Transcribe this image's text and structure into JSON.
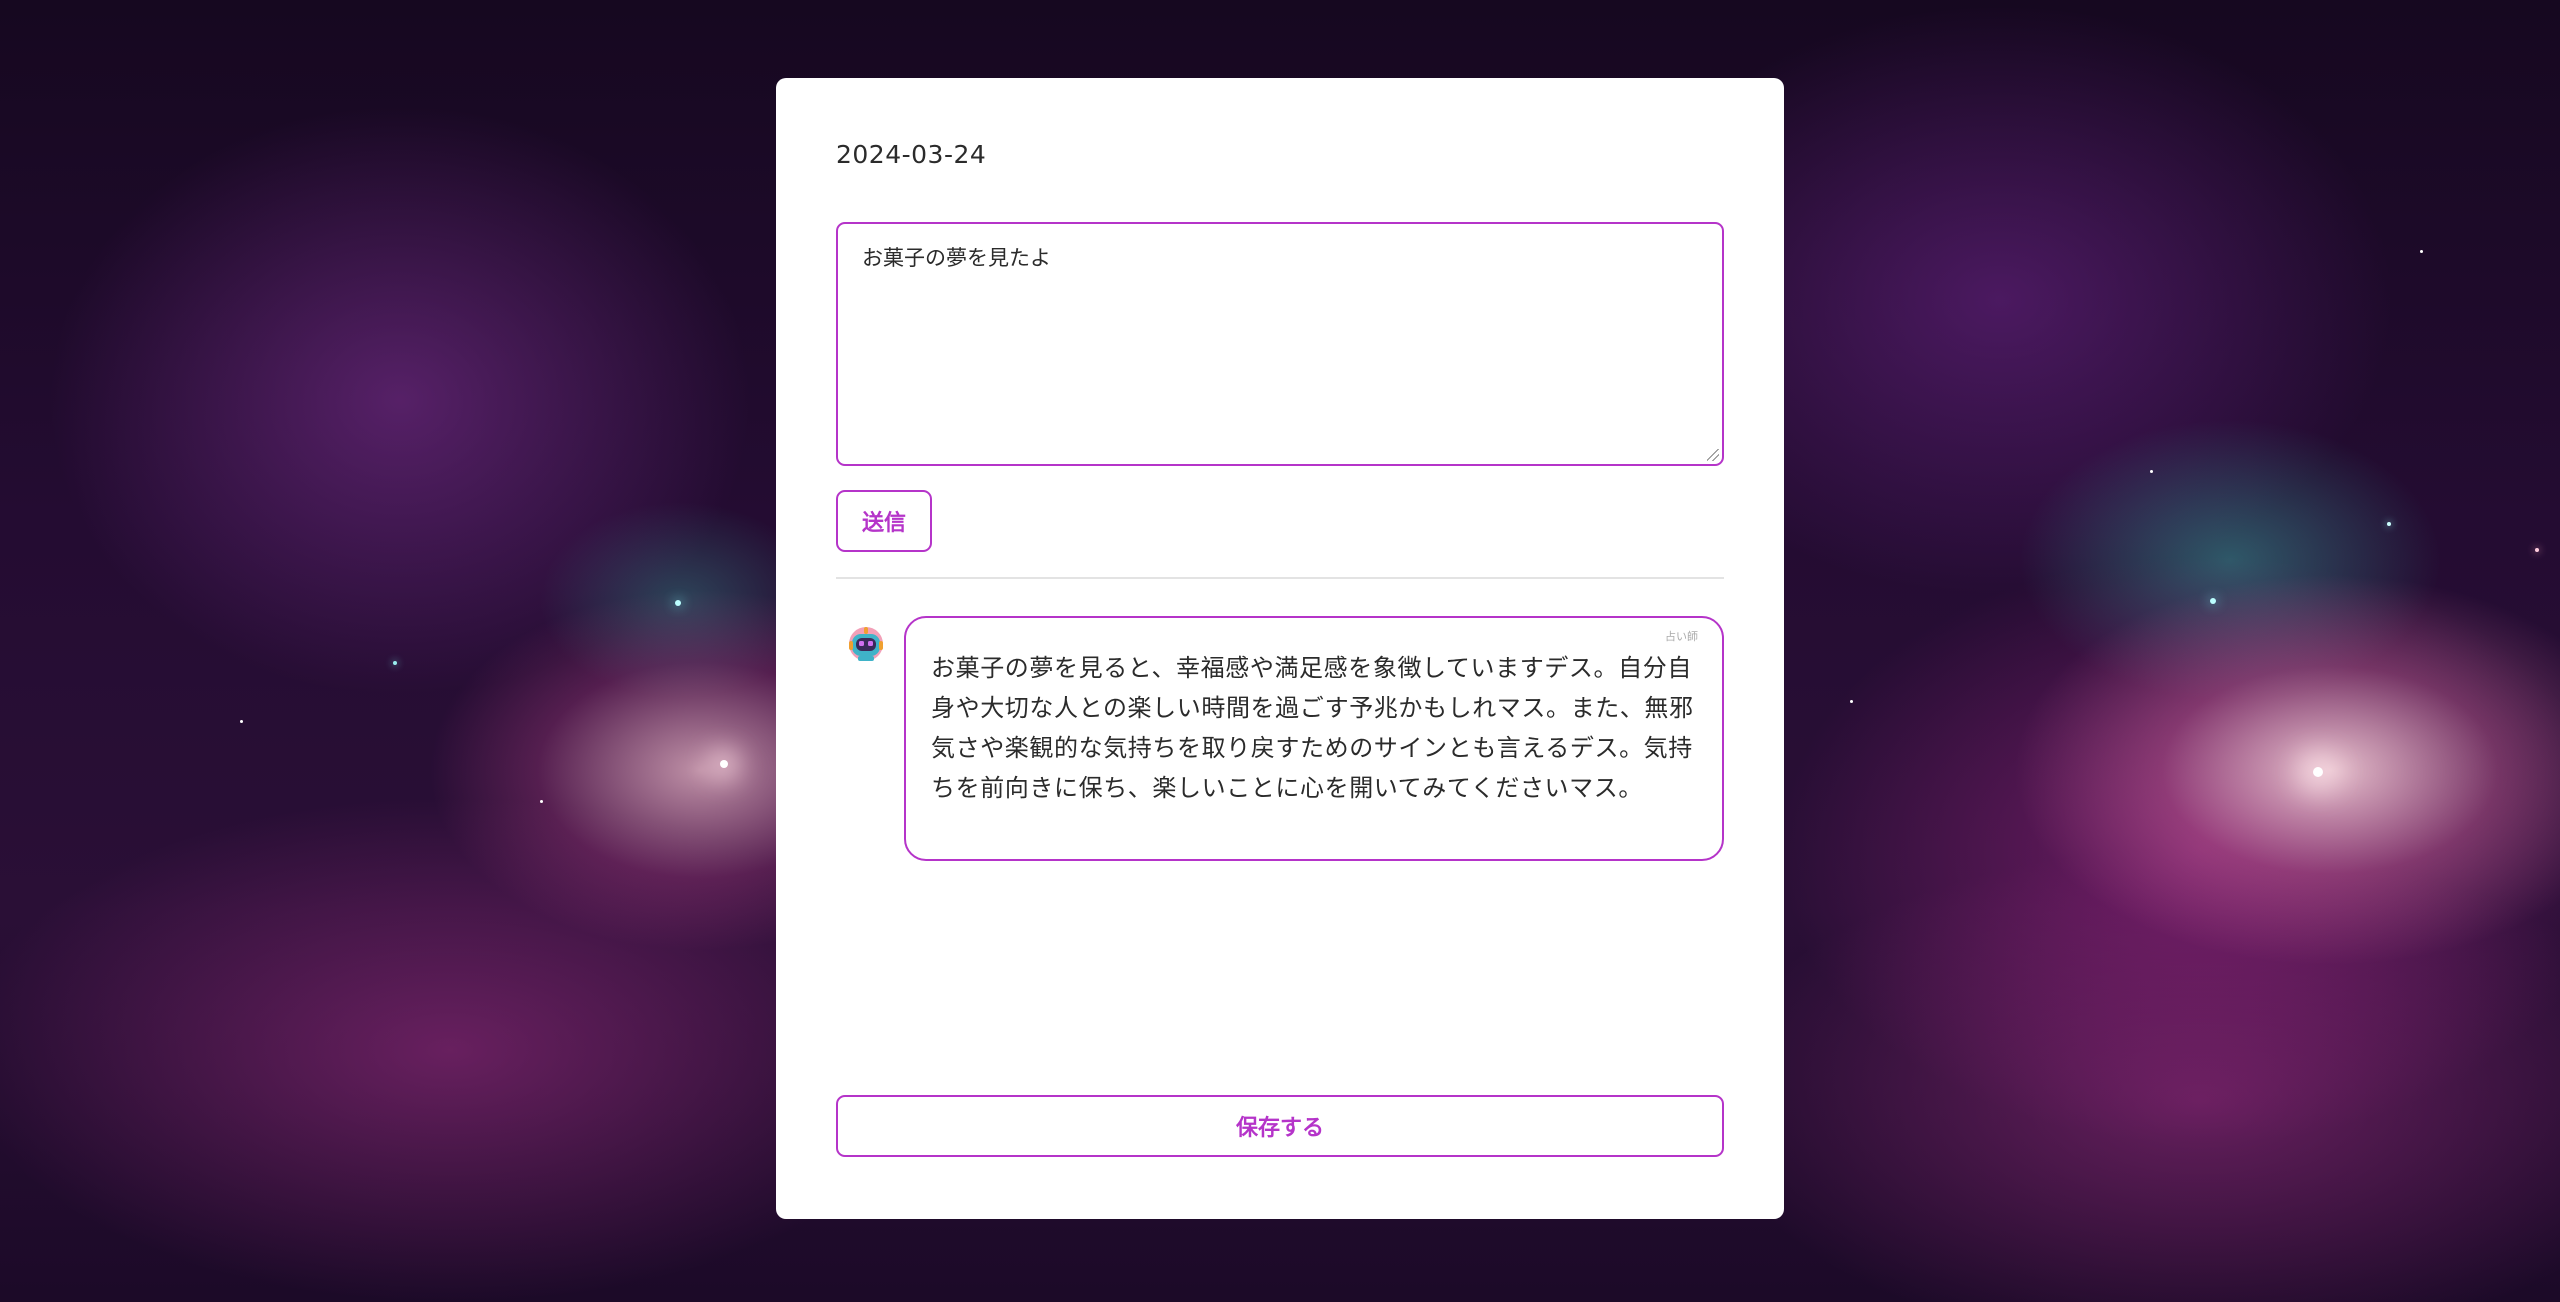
{
  "entry": {
    "date": "2024-03-24",
    "dream_text": "お菓子の夢を見たよ",
    "send_label": "送信",
    "save_label": "保存する"
  },
  "response": {
    "text": "お菓子の夢を見ると、幸福感や満足感を象徴していますデス。自分自身や大切な人との楽しい時間を過ごす予兆かもしれマス。また、無邪気さや楽観的な気持ちを取り戻すためのサインとも言えるデス。気持ちを前向きに保ち、楽しいことに心を開いてみてくださいマス。",
    "corner_label": "占い師",
    "avatar_icon": "robot-avatar-icon"
  },
  "colors": {
    "accent": "#b534c9",
    "card_background": "#ffffff",
    "text": "#2b2b2b"
  }
}
